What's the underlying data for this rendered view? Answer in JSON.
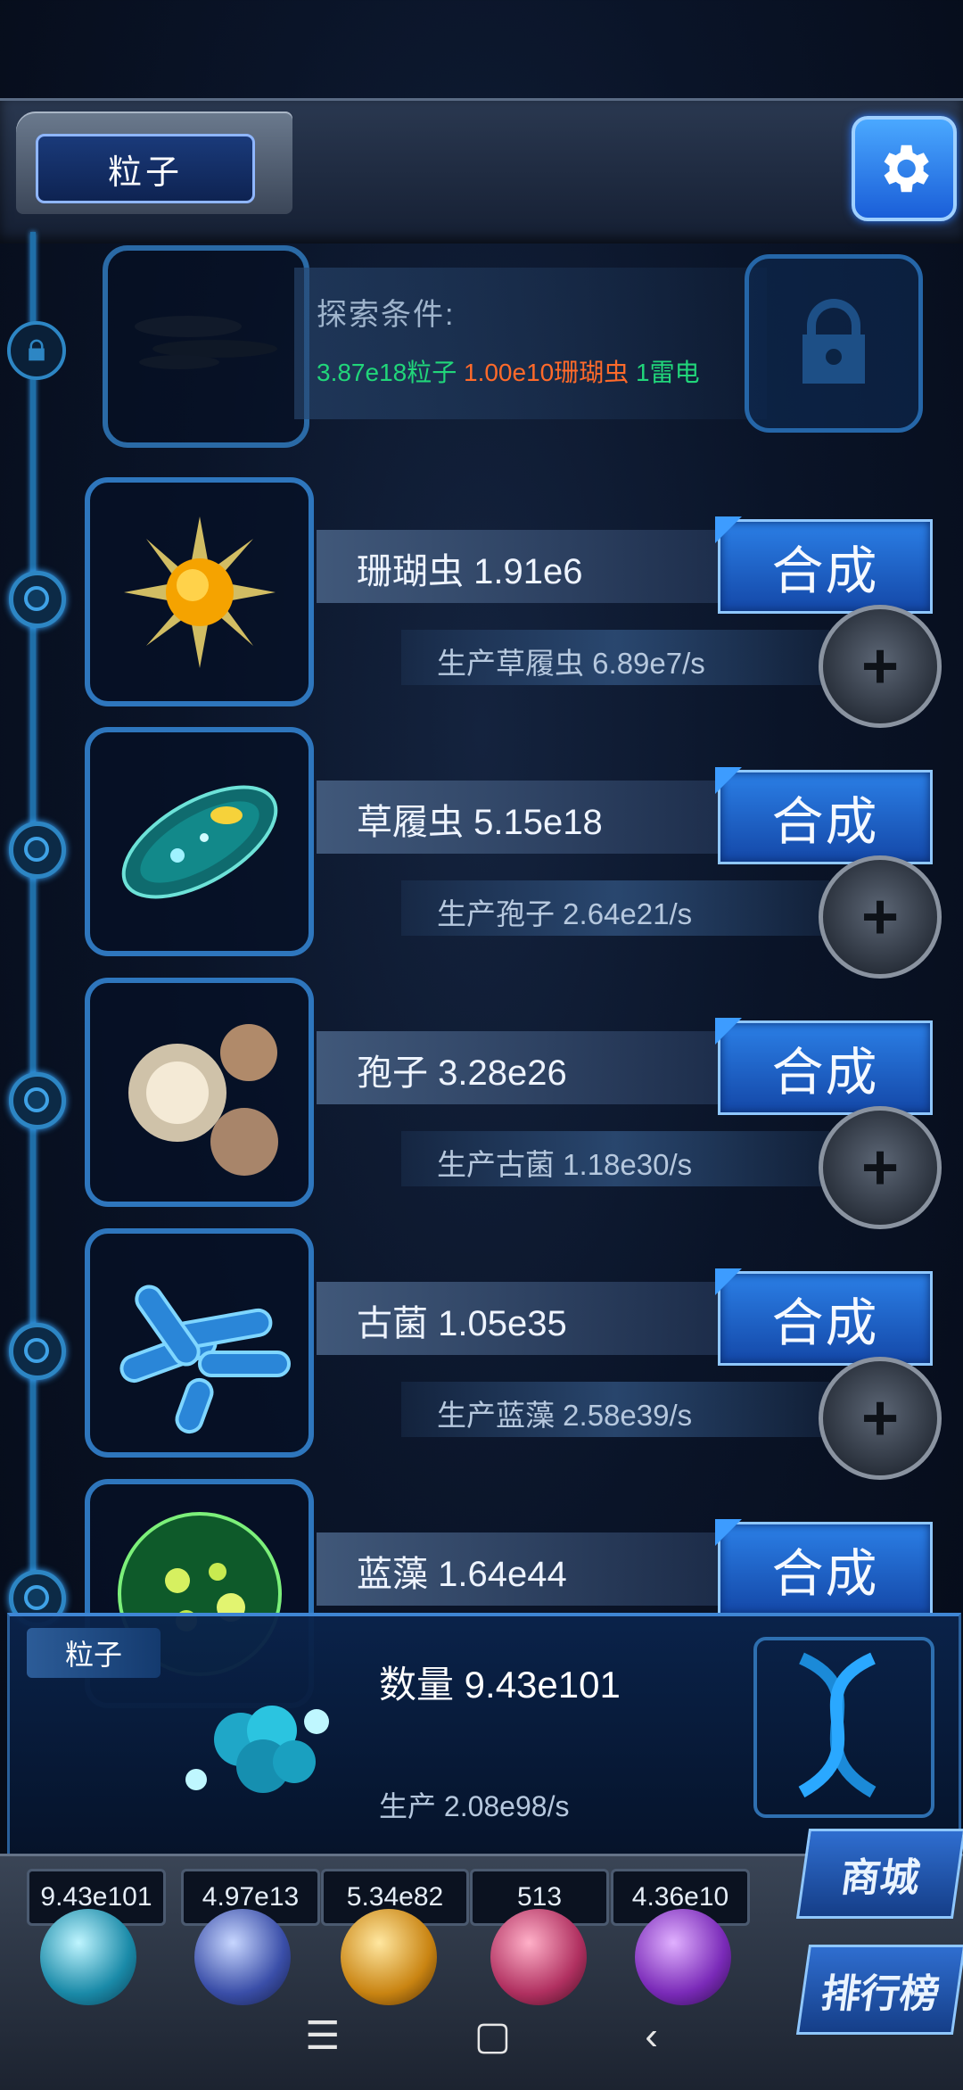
{
  "header": {
    "title": "粒子"
  },
  "explore": {
    "label": "探索条件:",
    "cond_particles": "3.87e18粒子",
    "cond_coral": "1.00e10珊瑚虫",
    "cond_thunder": "1雷电"
  },
  "rows": [
    {
      "name": "珊瑚虫 1.91e6",
      "synth": "合成",
      "production": "生产草履虫 6.89e7/s",
      "icon": "sun-creature-icon"
    },
    {
      "name": "草履虫 5.15e18",
      "synth": "合成",
      "production": "生产孢子 2.64e21/s",
      "icon": "paramecium-icon"
    },
    {
      "name": "孢子 3.28e26",
      "synth": "合成",
      "production": "生产古菌 1.18e30/s",
      "icon": "spore-icon"
    },
    {
      "name": "古菌 1.05e35",
      "synth": "合成",
      "production": "生产蓝藻 2.58e39/s",
      "icon": "archaea-icon"
    },
    {
      "name": "蓝藻 1.64e44",
      "synth": "合成",
      "icon": "cyanobacteria-icon"
    }
  ],
  "info": {
    "tag": "粒子",
    "count": "数量 9.43e101",
    "production": "生产 2.08e98/s"
  },
  "resources": [
    "9.43e101",
    "4.97e13",
    "5.34e82",
    "513",
    "4.36e10"
  ],
  "side_buttons": {
    "shop": "商城",
    "rank": "排行榜"
  },
  "sysnav": {
    "menu": "☰",
    "home": "▢",
    "back": "‹"
  },
  "colors": {
    "accent": "#2b7fe6",
    "green": "#21d67a",
    "orange": "#ff6a2a"
  }
}
